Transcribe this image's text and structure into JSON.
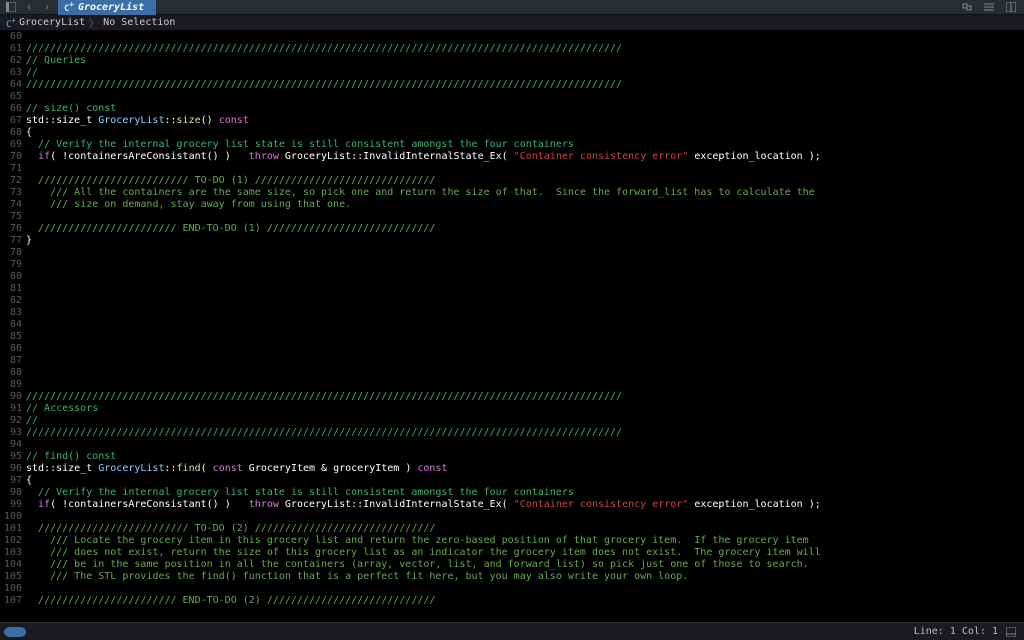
{
  "topbar": {
    "tab_label": "GroceryList"
  },
  "breadcrumb": {
    "file": "GroceryList",
    "sel": "No Selection"
  },
  "statusbar": {
    "pos": "Line: 1  Col: 1"
  },
  "lines": [
    {
      "n": 60,
      "h": ""
    },
    {
      "n": 61,
      "h": "<span class='c-green'>///////////////////////////////////////////////////////////////////////////////////////////////////</span>"
    },
    {
      "n": 62,
      "h": "<span class='c-green'>// Queries</span>"
    },
    {
      "n": 63,
      "h": "<span class='c-green'>//</span>"
    },
    {
      "n": 64,
      "h": "<span class='c-green'>///////////////////////////////////////////////////////////////////////////////////////////////////</span>"
    },
    {
      "n": 65,
      "h": ""
    },
    {
      "n": 66,
      "h": "<span class='c-green'>// size() const</span>"
    },
    {
      "n": 67,
      "h": "<span class='c-white'>std::size_t </span><span class='c-cls'>GroceryList</span><span class='c-white'>::</span><span class='c-func'>size</span><span class='c-white'>() </span><span class='c-key2'>const</span>"
    },
    {
      "n": 68,
      "h": "<span class='c-white'>{</span>"
    },
    {
      "n": 69,
      "h": "  <span class='c-green'>// Verify the internal grocery list state is still consistent amongst the four containers</span>"
    },
    {
      "n": 70,
      "h": "  <span class='c-key2'>if</span><span class='c-white'>( !containersAreConsistant() )   </span><span class='c-key2'>throw</span><span class='c-white'> GroceryList::InvalidInternalState_Ex( </span><span class='c-str'>\"Container consistency error\"</span><span class='c-white'> exception_location );</span>"
    },
    {
      "n": 71,
      "h": ""
    },
    {
      "n": 72,
      "h": "  <span class='c-dim'>///////////////////////// TO-DO (1) //////////////////////////////</span>"
    },
    {
      "n": 73,
      "h": "    <span class='c-dim'>/// All the containers are the same size, so pick one and return the size of that.  Since the forward_list has to calculate the</span>"
    },
    {
      "n": 74,
      "h": "    <span class='c-dim'>/// size on demand, stay away from using that one.</span>"
    },
    {
      "n": 75,
      "h": ""
    },
    {
      "n": 76,
      "h": "  <span class='c-dim'>/////////////////////// END-TO-DO (1) ////////////////////////////</span>"
    },
    {
      "n": 77,
      "h": "<span class='c-white'>}</span>"
    },
    {
      "n": 78,
      "h": ""
    },
    {
      "n": 79,
      "h": ""
    },
    {
      "n": 80,
      "h": ""
    },
    {
      "n": 81,
      "h": ""
    },
    {
      "n": 82,
      "h": ""
    },
    {
      "n": 83,
      "h": ""
    },
    {
      "n": 84,
      "h": ""
    },
    {
      "n": 85,
      "h": ""
    },
    {
      "n": 86,
      "h": ""
    },
    {
      "n": 87,
      "h": ""
    },
    {
      "n": 88,
      "h": ""
    },
    {
      "n": 89,
      "h": ""
    },
    {
      "n": 90,
      "h": "<span class='c-green'>///////////////////////////////////////////////////////////////////////////////////////////////////</span>"
    },
    {
      "n": 91,
      "h": "<span class='c-green'>// Accessors</span>"
    },
    {
      "n": 92,
      "h": "<span class='c-green'>//</span>"
    },
    {
      "n": 93,
      "h": "<span class='c-green'>///////////////////////////////////////////////////////////////////////////////////////////////////</span>"
    },
    {
      "n": 94,
      "h": ""
    },
    {
      "n": 95,
      "h": "<span class='c-green'>// find() const</span>"
    },
    {
      "n": 96,
      "h": "<span class='c-white'>std::size_t </span><span class='c-cls'>GroceryList</span><span class='c-white'>::</span><span class='c-func'>find</span><span class='c-white'>( </span><span class='c-key2'>const</span><span class='c-white'> GroceryItem &amp; groceryItem ) </span><span class='c-key2'>const</span>"
    },
    {
      "n": 97,
      "h": "<span class='c-white'>{</span>"
    },
    {
      "n": 98,
      "h": "  <span class='c-green'>// Verify the internal grocery list state is still consistent amongst the four containers</span>"
    },
    {
      "n": 99,
      "h": "  <span class='c-key2'>if</span><span class='c-white'>( !containersAreConsistant() )   </span><span class='c-key2'>throw</span><span class='c-white'> GroceryList::InvalidInternalState_Ex( </span><span class='c-str'>\"Container consistency error\"</span><span class='c-white'> exception_location );</span>"
    },
    {
      "n": 100,
      "h": ""
    },
    {
      "n": 101,
      "h": "  <span class='c-dim'>///////////////////////// TO-DO (2) //////////////////////////////</span>"
    },
    {
      "n": 102,
      "h": "    <span class='c-dim'>/// Locate the grocery item in this grocery list and return the zero-based position of that grocery item.  If the grocery item</span>"
    },
    {
      "n": 103,
      "h": "    <span class='c-dim'>/// does not exist, return the size of this grocery list as an indicator the grocery item does not exist.  The grocery item will</span>"
    },
    {
      "n": 104,
      "h": "    <span class='c-dim'>/// be in the same position in all the containers (array, vector, list, and forward_list) so pick just one of those to search.</span>"
    },
    {
      "n": 105,
      "h": "    <span class='c-dim'>/// The STL provides the find() function that is a perfect fit here, but you may also write your own loop.</span>"
    },
    {
      "n": 106,
      "h": ""
    },
    {
      "n": 107,
      "h": "  <span class='c-dim'>/////////////////////// END-TO-DO (2) ////////////////////////////</span>"
    }
  ]
}
